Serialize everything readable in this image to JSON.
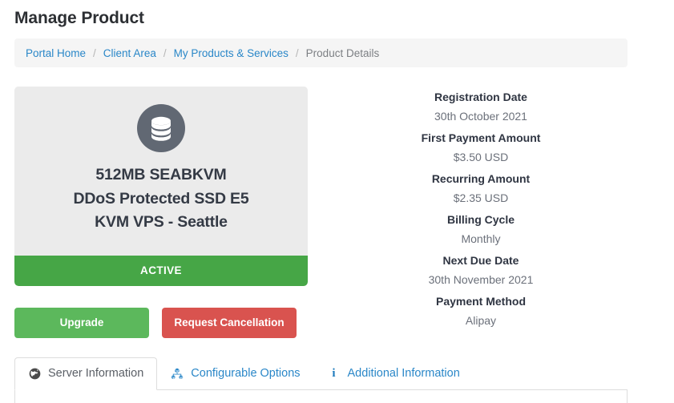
{
  "page": {
    "title": "Manage Product"
  },
  "breadcrumb": {
    "separator": "/",
    "items": [
      {
        "label": "Portal Home",
        "active": false
      },
      {
        "label": "Client Area",
        "active": false
      },
      {
        "label": "My Products & Services",
        "active": false
      },
      {
        "label": "Product Details",
        "active": true
      }
    ]
  },
  "product_card": {
    "icon": "database-icon",
    "title_lines": [
      "512MB SEABKVM",
      "DDoS Protected SSD E5",
      "KVM VPS - Seattle"
    ],
    "status_label": "ACTIVE",
    "status_color": "#46a646",
    "background_color": "#ebebeb",
    "icon_circle_color": "#616873"
  },
  "actions": {
    "upgrade_label": "Upgrade",
    "upgrade_color": "#5cb85c",
    "cancel_label": "Request Cancellation",
    "cancel_color": "#d9534f"
  },
  "info": {
    "rows": [
      {
        "label": "Registration Date",
        "value": "30th October 2021"
      },
      {
        "label": "First Payment Amount",
        "value": "$3.50 USD"
      },
      {
        "label": "Recurring Amount",
        "value": "$2.35 USD"
      },
      {
        "label": "Billing Cycle",
        "value": "Monthly"
      },
      {
        "label": "Next Due Date",
        "value": "30th November 2021"
      },
      {
        "label": "Payment Method",
        "value": "Alipay"
      }
    ]
  },
  "tabs": [
    {
      "label": "Server Information",
      "icon": "globe-icon",
      "active": true
    },
    {
      "label": "Configurable Options",
      "icon": "sitemap-icon",
      "active": false
    },
    {
      "label": "Additional Information",
      "icon": "info-icon",
      "active": false
    }
  ],
  "colors": {
    "link": "#2a87c8",
    "muted_text": "#6b707a",
    "border": "#dddddd",
    "breadcrumb_bg": "#f5f5f5"
  }
}
